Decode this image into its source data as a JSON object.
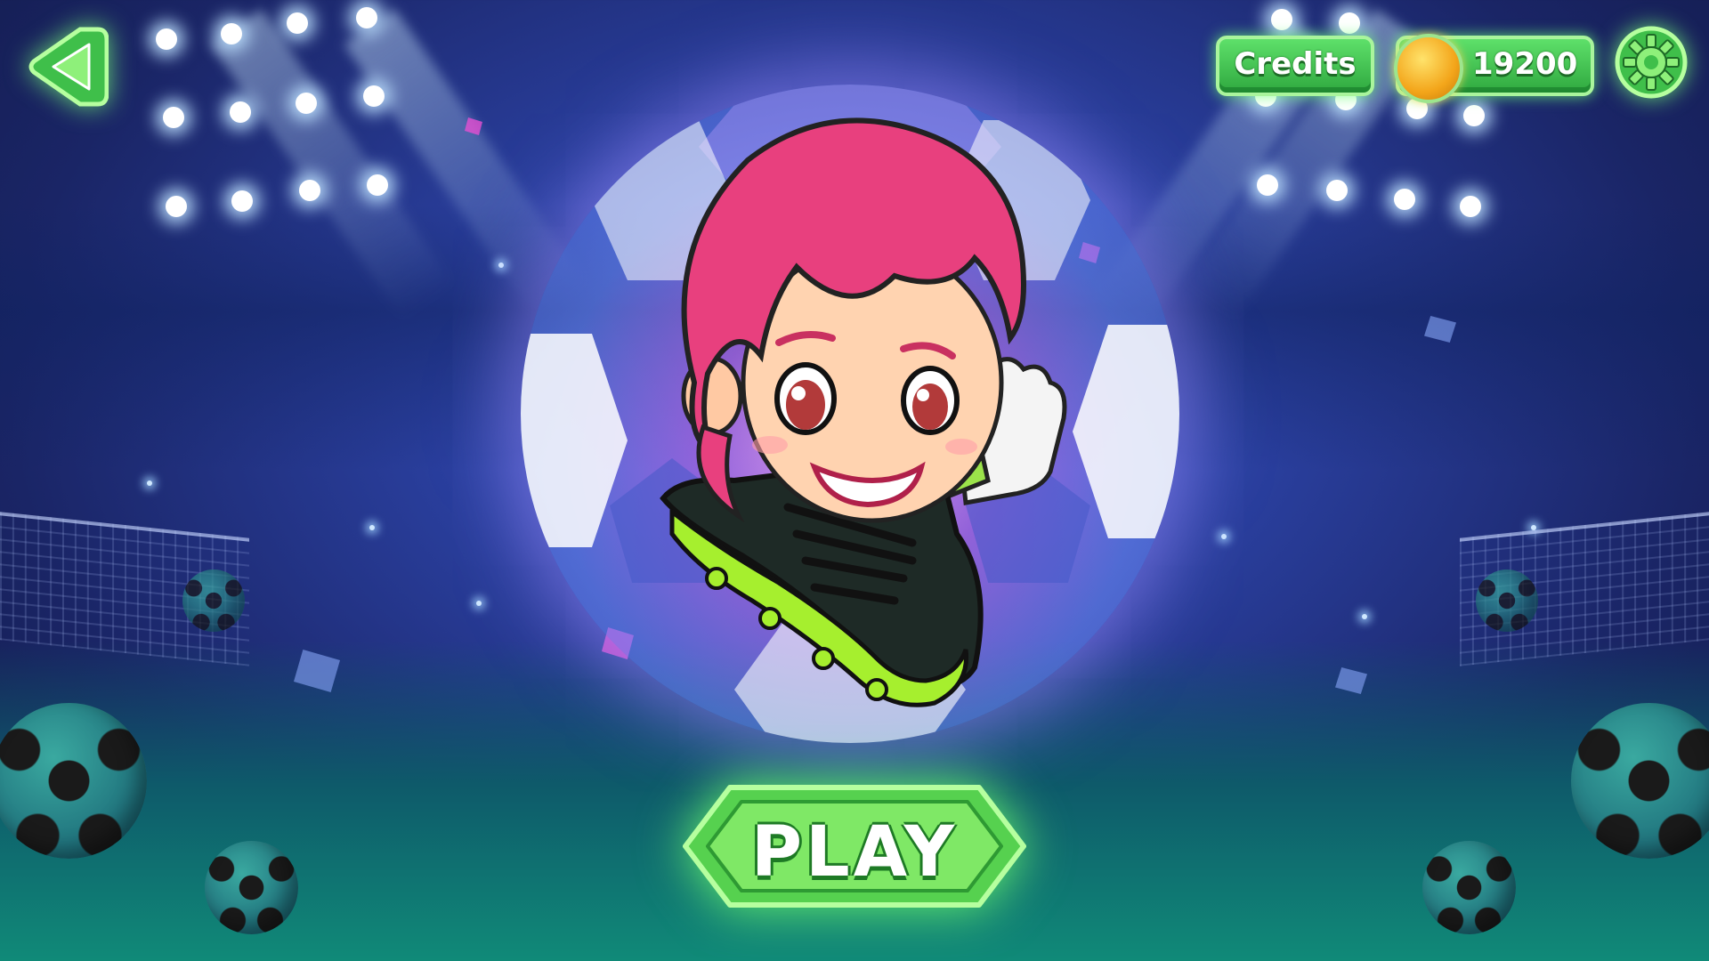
{
  "hud": {
    "credits_label": "Credits",
    "coins": "19200"
  },
  "main": {
    "play_label": "PLAY"
  },
  "icons": {
    "back": "back-arrow-icon",
    "coin": "coin-icon",
    "settings": "gear-icon"
  },
  "colors": {
    "button_green": "#4fcf5b",
    "button_border": "#a9f59c",
    "hair_pink": "#e8407e",
    "background_blue": "#2a3f9e"
  }
}
